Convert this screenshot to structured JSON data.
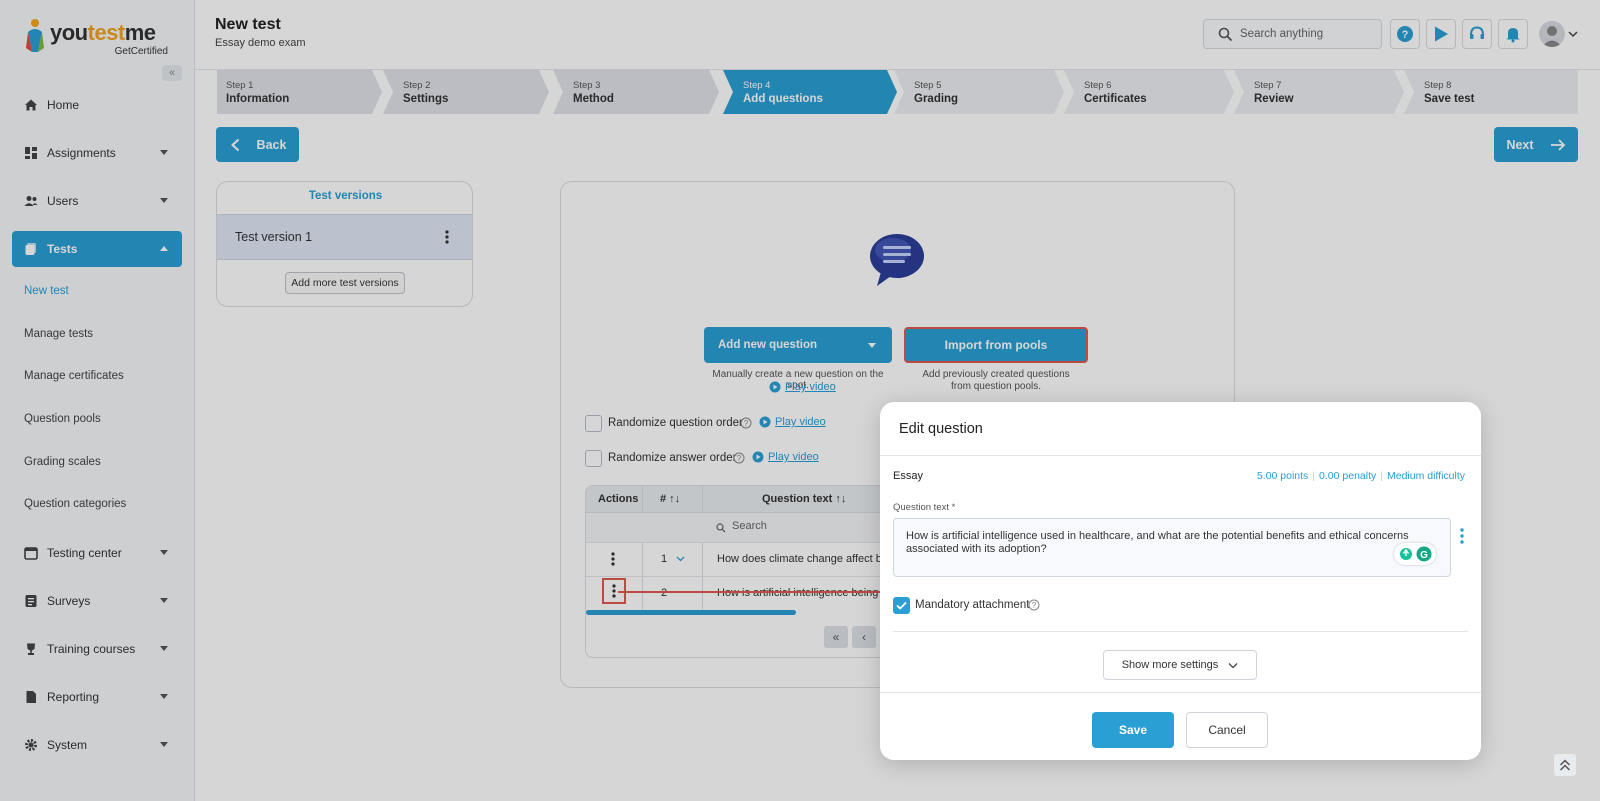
{
  "brand": {
    "name_a": "you",
    "name_b": "test",
    "name_c": "me",
    "sub": "GetCertified"
  },
  "sidebar": {
    "items": [
      {
        "label": "Home"
      },
      {
        "label": "Assignments"
      },
      {
        "label": "Users"
      },
      {
        "label": "Tests"
      },
      {
        "label": "Testing center"
      },
      {
        "label": "Surveys"
      },
      {
        "label": "Training courses"
      },
      {
        "label": "Reporting"
      },
      {
        "label": "System"
      }
    ],
    "tests_sub": [
      "New test",
      "Manage tests",
      "Manage certificates",
      "Question pools",
      "Grading scales",
      "Question categories"
    ]
  },
  "header": {
    "title": "New test",
    "subtitle": "Essay demo exam",
    "search_placeholder": "Search anything"
  },
  "steps": [
    {
      "num": "Step 1",
      "label": "Information"
    },
    {
      "num": "Step 2",
      "label": "Settings"
    },
    {
      "num": "Step 3",
      "label": "Method"
    },
    {
      "num": "Step 4",
      "label": "Add questions"
    },
    {
      "num": "Step 5",
      "label": "Grading"
    },
    {
      "num": "Step 6",
      "label": "Certificates"
    },
    {
      "num": "Step 7",
      "label": "Review"
    },
    {
      "num": "Step 8",
      "label": "Save test"
    }
  ],
  "nav_buttons": {
    "back": "Back",
    "next": "Next"
  },
  "versions": {
    "title": "Test versions",
    "item": "Test version 1",
    "add": "Add more test versions"
  },
  "questions": {
    "add_new": "Add new question",
    "add_new_desc": "Manually create a new question on the spot.",
    "import": "Import from pools",
    "import_desc": "Add previously created questions from question pools.",
    "play_video": "Play video",
    "randomize_q": "Randomize question order",
    "randomize_a": "Randomize answer order",
    "table": {
      "headers": [
        "Actions",
        "#",
        "Question text"
      ],
      "search_placeholder": "Search",
      "rows": [
        {
          "num": "1",
          "text": "How does climate change affect b"
        },
        {
          "num": "2",
          "text": "How is artificial intelligence being"
        }
      ]
    }
  },
  "modal": {
    "title": "Edit question",
    "type": "Essay",
    "points": "5.00 points",
    "penalty": "0.00 penalty",
    "difficulty": "Medium difficulty",
    "question_label": "Question text *",
    "question_text": "How is artificial intelligence used in healthcare, and what are the potential benefits and ethical concerns associated with its adoption?",
    "mandatory": "Mandatory attachment",
    "mandatory_checked": true,
    "show_more": "Show more settings",
    "save": "Save",
    "cancel": "Cancel"
  },
  "colors": {
    "accent": "#2a9fd3",
    "highlight": "#e05a4f"
  }
}
